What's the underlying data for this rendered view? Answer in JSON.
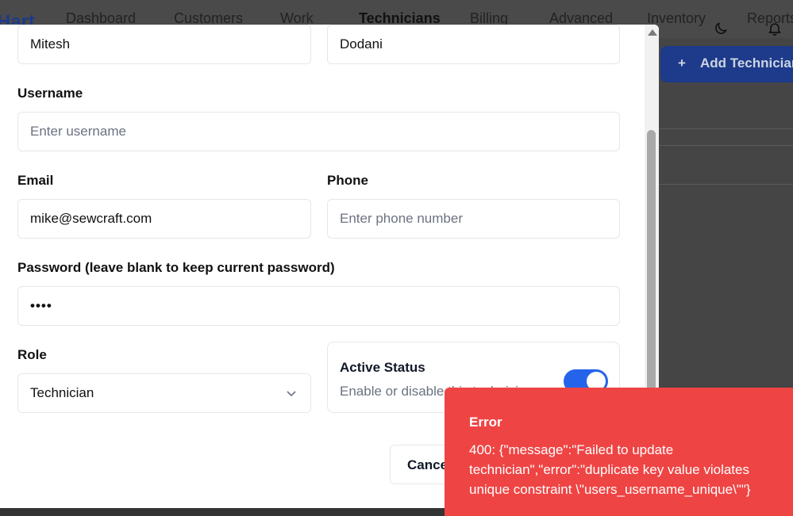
{
  "app": {
    "logo_text": "Hart",
    "nav": [
      "Dashboard",
      "Customers",
      "Work",
      "Technicians",
      "Billing",
      "Advanced",
      "Inventory",
      "Reports"
    ],
    "active_nav": "Technicians",
    "add_button_label": "Add Technician"
  },
  "form": {
    "first_name_value": "Mitesh",
    "last_name_value": "Dodani",
    "username_label": "Username",
    "username_placeholder": "Enter username",
    "email_label": "Email",
    "email_value": "mike@sewcraft.com",
    "phone_label": "Phone",
    "phone_placeholder": "Enter phone number",
    "password_label": "Password (leave blank to keep current password)",
    "password_value": "••••",
    "role_label": "Role",
    "role_value": "Technician",
    "active_status_title": "Active Status",
    "active_status_desc": "Enable or disable this technician",
    "active_status_on": true,
    "cancel_label": "Cancel"
  },
  "toast": {
    "title": "Error",
    "message": "400: {\"message\":\"Failed to update technician\",\"error\":\"duplicate key value violates unique constraint \\\"users_username_unique\\\"\"}"
  },
  "colors": {
    "accent": "#2563eb",
    "error": "#ef4444"
  }
}
